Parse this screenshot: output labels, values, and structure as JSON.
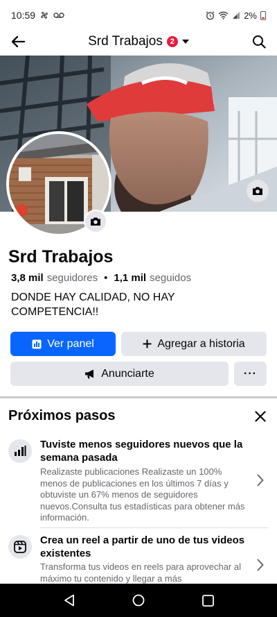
{
  "status_bar": {
    "time": "10:59",
    "battery": "2%"
  },
  "header": {
    "title": "Srd Trabajos",
    "badge": "2"
  },
  "profile": {
    "name": "Srd Trabajos",
    "followers_count": "3,8 mil",
    "followers_label": "seguidores",
    "separator": "•",
    "following_count": "1,1 mil",
    "following_label": "seguidos",
    "bio": "DONDE HAY CALIDAD, NO HAY COMPETENCIA!!"
  },
  "actions": {
    "dashboard": "Ver panel",
    "add_story": "Agregar a historia",
    "advertise": "Anunciarte",
    "more": "···"
  },
  "next_steps": {
    "title": "Próximos pasos",
    "items": [
      {
        "icon": "bar-chart-icon",
        "title": "Tuviste menos seguidores nuevos que la semana pasada",
        "description": "Realizaste publicaciones Realizaste un 100% menos de publicaciones en los últimos 7 días y obtuviste un 67% menos de seguidores nuevos.Consulta tus estadísticas para obtener más información."
      },
      {
        "icon": "reels-icon",
        "title": "Crea un reel a partir de uno de tus videos existentes",
        "description": "Transforma tus videos en reels para aprovechar al máximo tu contenido y llegar a más"
      }
    ]
  },
  "colors": {
    "primary": "#0866ff",
    "secondary_button": "#e4e6eb",
    "badge": "#e41e3f",
    "muted_text": "#65676b"
  }
}
